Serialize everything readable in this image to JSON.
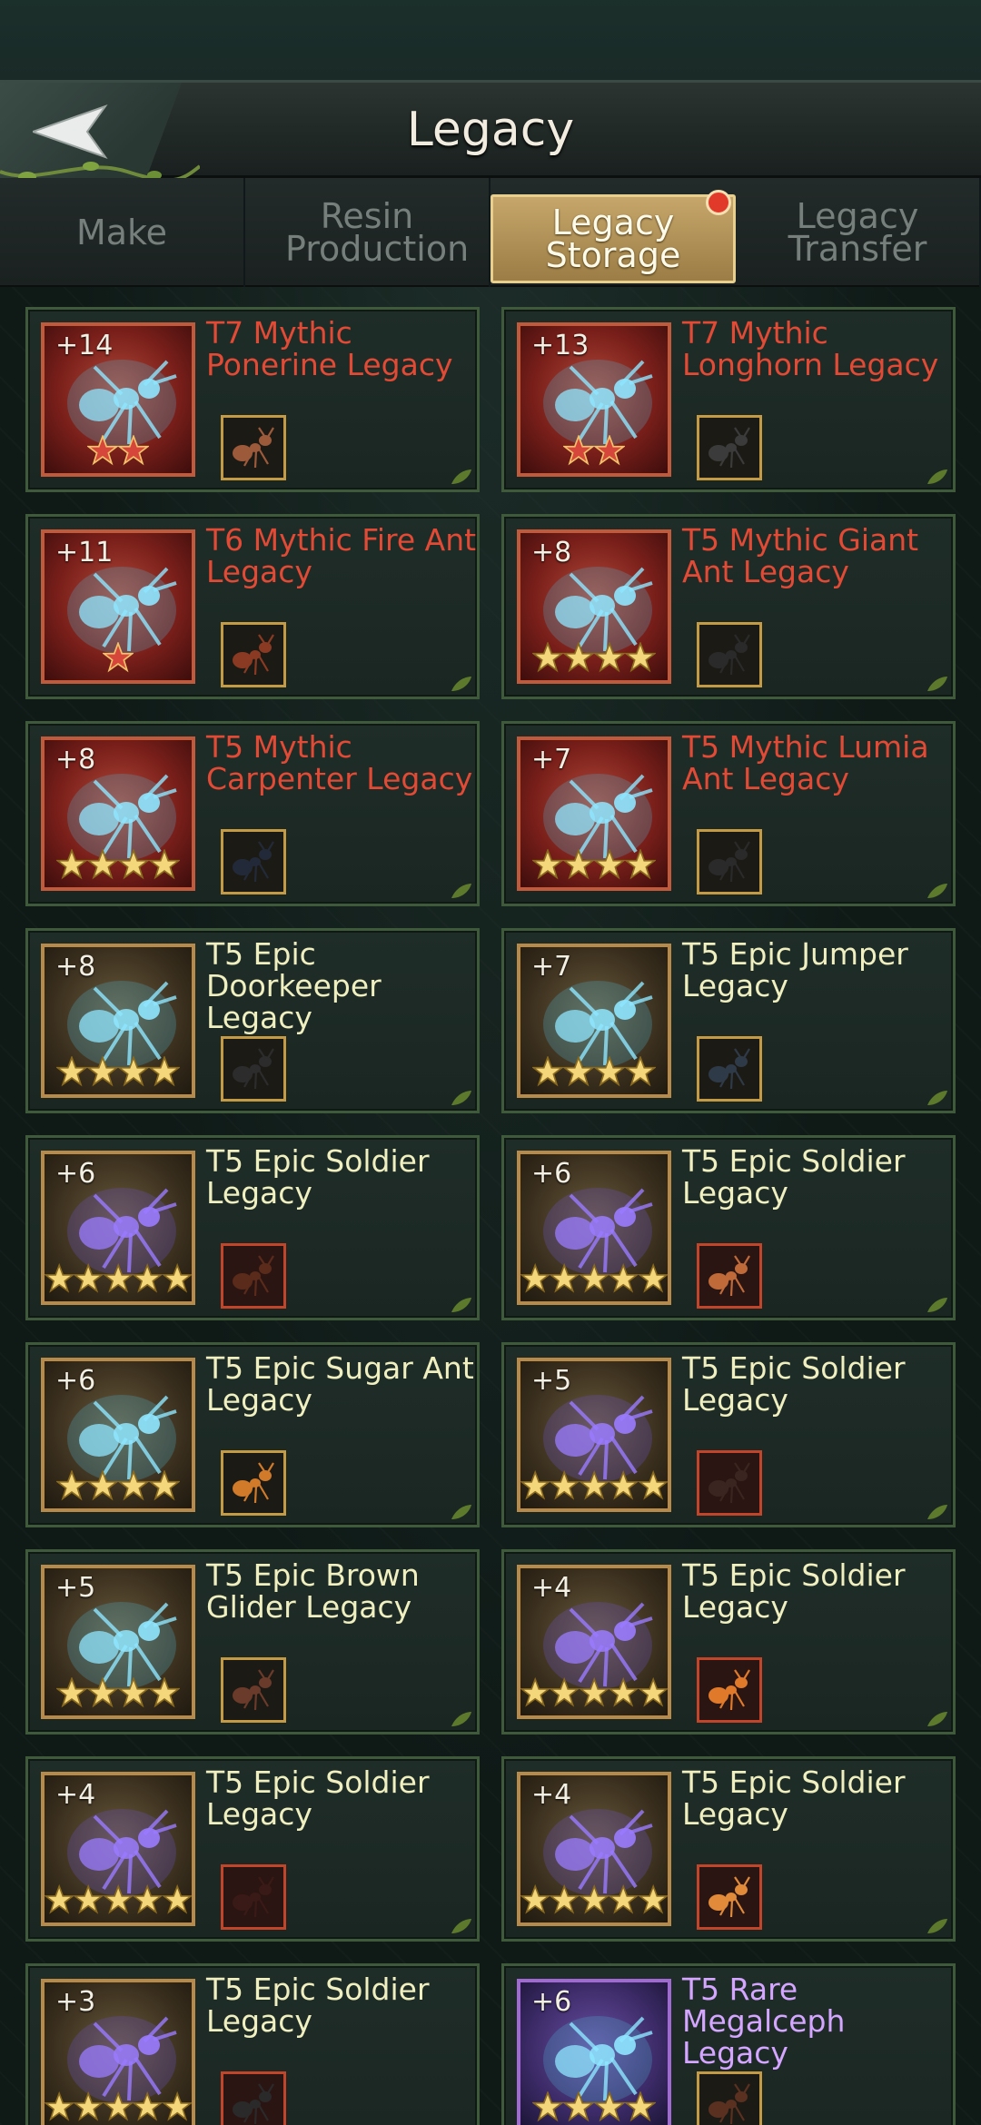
{
  "header": {
    "title": "Legacy"
  },
  "tabs": [
    {
      "label": "Make",
      "active": false
    },
    {
      "label": "Resin Production",
      "active": false
    },
    {
      "label": "Legacy Storage",
      "active": true,
      "badge": true
    },
    {
      "label": "Legacy Transfer",
      "active": false
    }
  ],
  "colors": {
    "mythic": "#e24a35",
    "epic": "#f0efc0",
    "rare": "#d4a6ff",
    "tab_active": "#c6a66a"
  },
  "legacies": [
    {
      "level": "+14",
      "name": "T7 Mythic Ponerine Legacy",
      "rarity": "mythic",
      "stars": 2,
      "art": "ghost-ant-icon",
      "thumb": "ponerine-ant-icon",
      "thumb_color": "#9c5a3a"
    },
    {
      "level": "+13",
      "name": "T7 Mythic Longhorn Legacy",
      "rarity": "mythic",
      "stars": 2,
      "art": "ghost-beetle-icon",
      "thumb": "longhorn-ant-icon",
      "thumb_color": "#3b3b3b"
    },
    {
      "level": "+11",
      "name": "T6 Mythic Fire Ant Legacy",
      "rarity": "mythic",
      "stars": 1,
      "art": "ghost-ant-icon",
      "thumb": "fire-ant-icon",
      "thumb_color": "#8a3a22"
    },
    {
      "level": "+8",
      "name": "T5 Mythic Giant Ant Legacy",
      "rarity": "mythic",
      "stars": 4,
      "art": "ghost-spider-icon",
      "thumb": "giant-ant-icon",
      "thumb_color": "#2a2a2a"
    },
    {
      "level": "+8",
      "name": "T5 Mythic Carpenter Legacy",
      "rarity": "mythic",
      "stars": 4,
      "art": "ghost-ant-icon",
      "thumb": "carpenter-ant-icon",
      "thumb_color": "#222a3a"
    },
    {
      "level": "+7",
      "name": "T5 Mythic Lumia Ant Legacy",
      "rarity": "mythic",
      "stars": 4,
      "art": "ghost-beetle-icon",
      "thumb": "lumia-ant-icon",
      "thumb_color": "#2a2a2a"
    },
    {
      "level": "+8",
      "name": "T5 Epic Doorkeeper Legacy",
      "rarity": "epic",
      "stars": 4,
      "art": "ghost-ant-icon",
      "thumb": "doorkeeper-ant-icon",
      "thumb_color": "#2c2c2c"
    },
    {
      "level": "+7",
      "name": "T5 Epic Jumper Legacy",
      "rarity": "epic",
      "stars": 4,
      "art": "ghost-ant-icon",
      "thumb": "jumper-ant-icon",
      "thumb_color": "#2f3a48"
    },
    {
      "level": "+6",
      "name": "T5 Epic Soldier Legacy",
      "rarity": "epic",
      "stars": 5,
      "art": "purple-spider-icon",
      "thumb": "soldier-ant-icon",
      "thumb_color": "#5a2a1a"
    },
    {
      "level": "+6",
      "name": "T5 Epic Soldier Legacy",
      "rarity": "epic",
      "stars": 5,
      "art": "purple-spider-icon",
      "thumb": "soldier-ant-icon",
      "thumb_color": "#c06a3a"
    },
    {
      "level": "+6",
      "name": "T5 Epic Sugar Ant Legacy",
      "rarity": "epic",
      "stars": 4,
      "art": "ghost-ant-icon",
      "thumb": "sugar-ant-icon",
      "thumb_color": "#d07a2a"
    },
    {
      "level": "+5",
      "name": "T5 Epic Soldier Legacy",
      "rarity": "epic",
      "stars": 5,
      "art": "purple-spider-icon",
      "thumb": "soldier-ant-icon",
      "thumb_color": "#3a2520"
    },
    {
      "level": "+5",
      "name": "T5 Epic Brown Glider Legacy",
      "rarity": "epic",
      "stars": 4,
      "art": "ghost-ant-icon",
      "thumb": "brown-glider-ant-icon",
      "thumb_color": "#6a3a2a"
    },
    {
      "level": "+4",
      "name": "T5 Epic Soldier Legacy",
      "rarity": "epic",
      "stars": 5,
      "art": "purple-spider-icon",
      "thumb": "soldier-ant-icon",
      "thumb_color": "#e07a2a"
    },
    {
      "level": "+4",
      "name": "T5 Epic Soldier Legacy",
      "rarity": "epic",
      "stars": 5,
      "art": "purple-spider-icon",
      "thumb": "soldier-ant-icon",
      "thumb_color": "#3a1a16"
    },
    {
      "level": "+4",
      "name": "T5 Epic Soldier Legacy",
      "rarity": "epic",
      "stars": 5,
      "art": "purple-spider-icon",
      "thumb": "soldier-ant-icon",
      "thumb_color": "#e08a3a"
    },
    {
      "level": "+3",
      "name": "T5 Epic Soldier Legacy",
      "rarity": "epic",
      "stars": 5,
      "art": "purple-spider-icon",
      "thumb": "soldier-ant-icon",
      "thumb_color": "#2a2a2a"
    },
    {
      "level": "+6",
      "name": "T5 Rare Megalceph Legacy",
      "rarity": "rare",
      "stars": 4,
      "art": "ghost-beetle-icon",
      "thumb": "megalceph-ant-icon",
      "thumb_color": "#5a3020"
    }
  ]
}
